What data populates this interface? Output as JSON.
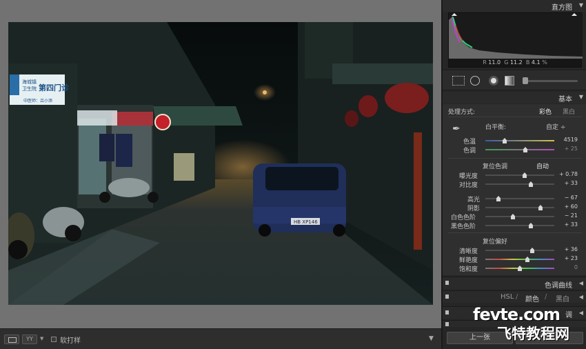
{
  "toolbar": {
    "compare_label": "YY",
    "softproof_label": "软打样",
    "menu_glyph": "▼"
  },
  "photo": {
    "sign_left_line1": "海城镇",
    "sign_left_line2": "卫生院",
    "sign_left_big": "第四门诊",
    "sign_left_sub": "中医师：吕小添",
    "license_plate": "HB XP146"
  },
  "histogram": {
    "header": "直方图",
    "readout_r_label": "R",
    "readout_r": "11.0",
    "readout_g_label": "G",
    "readout_g": "11.2",
    "readout_b_label": "B",
    "readout_b": "4.1",
    "readout_unit": "%"
  },
  "basic": {
    "header": "基本",
    "treatment_label": "处理方式:",
    "treatment_color": "彩色",
    "treatment_bw": "黑白",
    "wb_label": "白平衡:",
    "wb_value": "自定 ÷",
    "temp_label": "色温",
    "temp_value": "4519",
    "temp_pos": 0.28,
    "tint_label": "色调",
    "tint_value": "+ 25",
    "tint_pos": 0.58,
    "tone_label": "复位色调",
    "auto_label": "自动",
    "exposure_label": "曝光度",
    "exposure_value": "+ 0.78",
    "exposure_pos": 0.57,
    "contrast_label": "对比度",
    "contrast_value": "+ 33",
    "contrast_pos": 0.66,
    "highlights_label": "高光",
    "highlights_value": "− 67",
    "highlights_pos": 0.19,
    "shadows_label": "阴影",
    "shadows_value": "+ 60",
    "shadows_pos": 0.8,
    "whites_label": "白色色阶",
    "whites_value": "− 21",
    "whites_pos": 0.4,
    "blacks_label": "黑色色阶",
    "blacks_value": "+ 33",
    "blacks_pos": 0.66,
    "presence_label": "复位偏好",
    "clarity_label": "清晰度",
    "clarity_value": "+ 36",
    "clarity_pos": 0.68,
    "vibrance_label": "鲜艳度",
    "vibrance_value": "+ 23",
    "vibrance_pos": 0.61,
    "saturation_label": "饱和度",
    "saturation_value": "0",
    "saturation_pos": 0.5
  },
  "panels": {
    "tone_curve": "色调曲线",
    "hsl_tab": "HSL",
    "color_tab": "颜色",
    "bw_tab": "黑白",
    "split_toning": "调"
  },
  "nav": {
    "prev_label": "上一张"
  },
  "watermark": {
    "line1": "fevte.com",
    "line2": "飞特教程网"
  },
  "colors": {
    "panel_bg": "#2f2f2f",
    "canvas_bg": "#727272"
  }
}
